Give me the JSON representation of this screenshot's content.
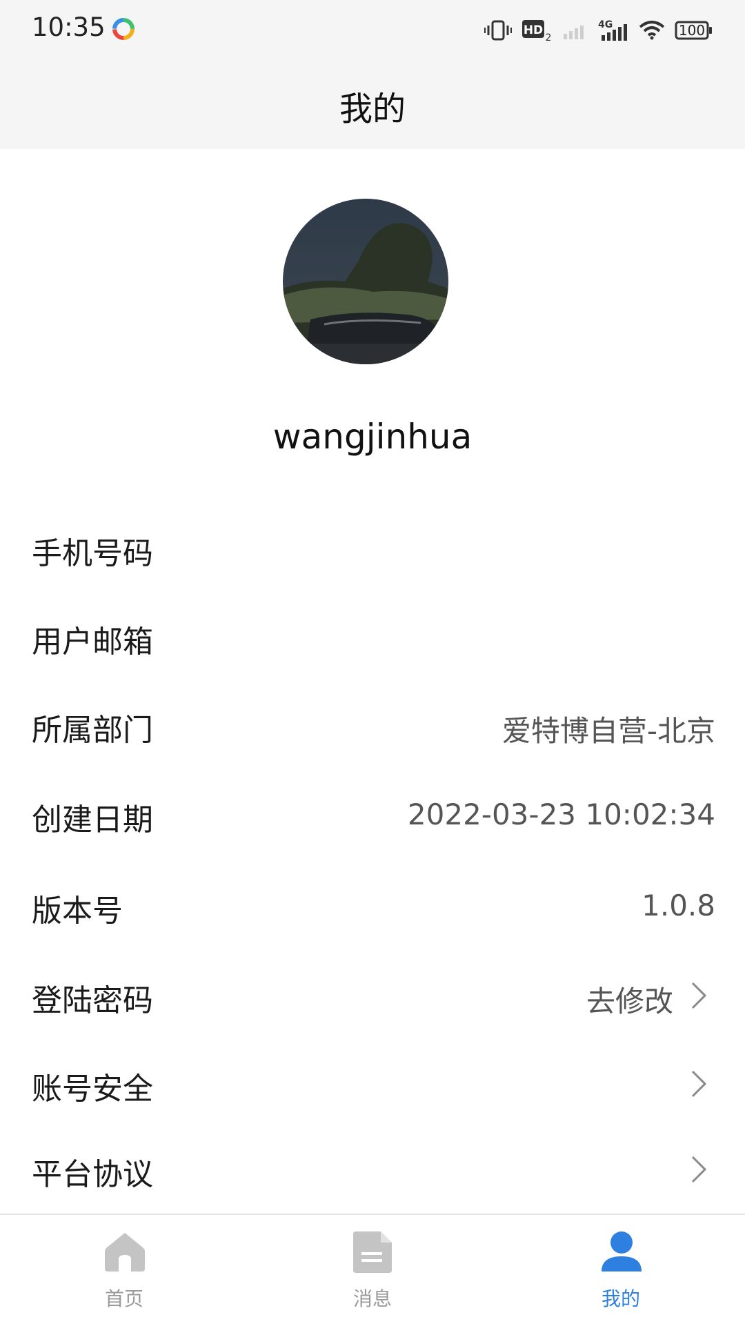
{
  "status_bar": {
    "time": "10:35",
    "network_label": "4G",
    "hd_label": "HD",
    "hd_sub": "2",
    "battery": "100"
  },
  "header": {
    "title": "我的"
  },
  "profile": {
    "username": "wangjinhua"
  },
  "info_rows": [
    {
      "label": "手机号码",
      "value": "",
      "chevron": false
    },
    {
      "label": "用户邮箱",
      "value": "",
      "chevron": false
    },
    {
      "label": "所属部门",
      "value": "爱特博自营-北京",
      "chevron": false
    },
    {
      "label": "创建日期",
      "value": "2022-03-23 10:02:34",
      "chevron": false
    },
    {
      "label": "版本号",
      "value": "1.0.8",
      "chevron": false
    },
    {
      "label": "登陆密码",
      "value": "去修改",
      "chevron": true
    },
    {
      "label": "账号安全",
      "value": "",
      "chevron": true
    },
    {
      "label": "平台协议",
      "value": "",
      "chevron": true
    }
  ],
  "tab_bar": {
    "tabs": [
      {
        "label": "首页",
        "icon": "home-icon",
        "active": false
      },
      {
        "label": "消息",
        "icon": "document-icon",
        "active": false
      },
      {
        "label": "我的",
        "icon": "user-icon",
        "active": true
      }
    ]
  },
  "colors": {
    "accent": "#2d7fe0",
    "inactive_tab": "#c4c4c4",
    "header_bg": "#f5f5f5"
  }
}
